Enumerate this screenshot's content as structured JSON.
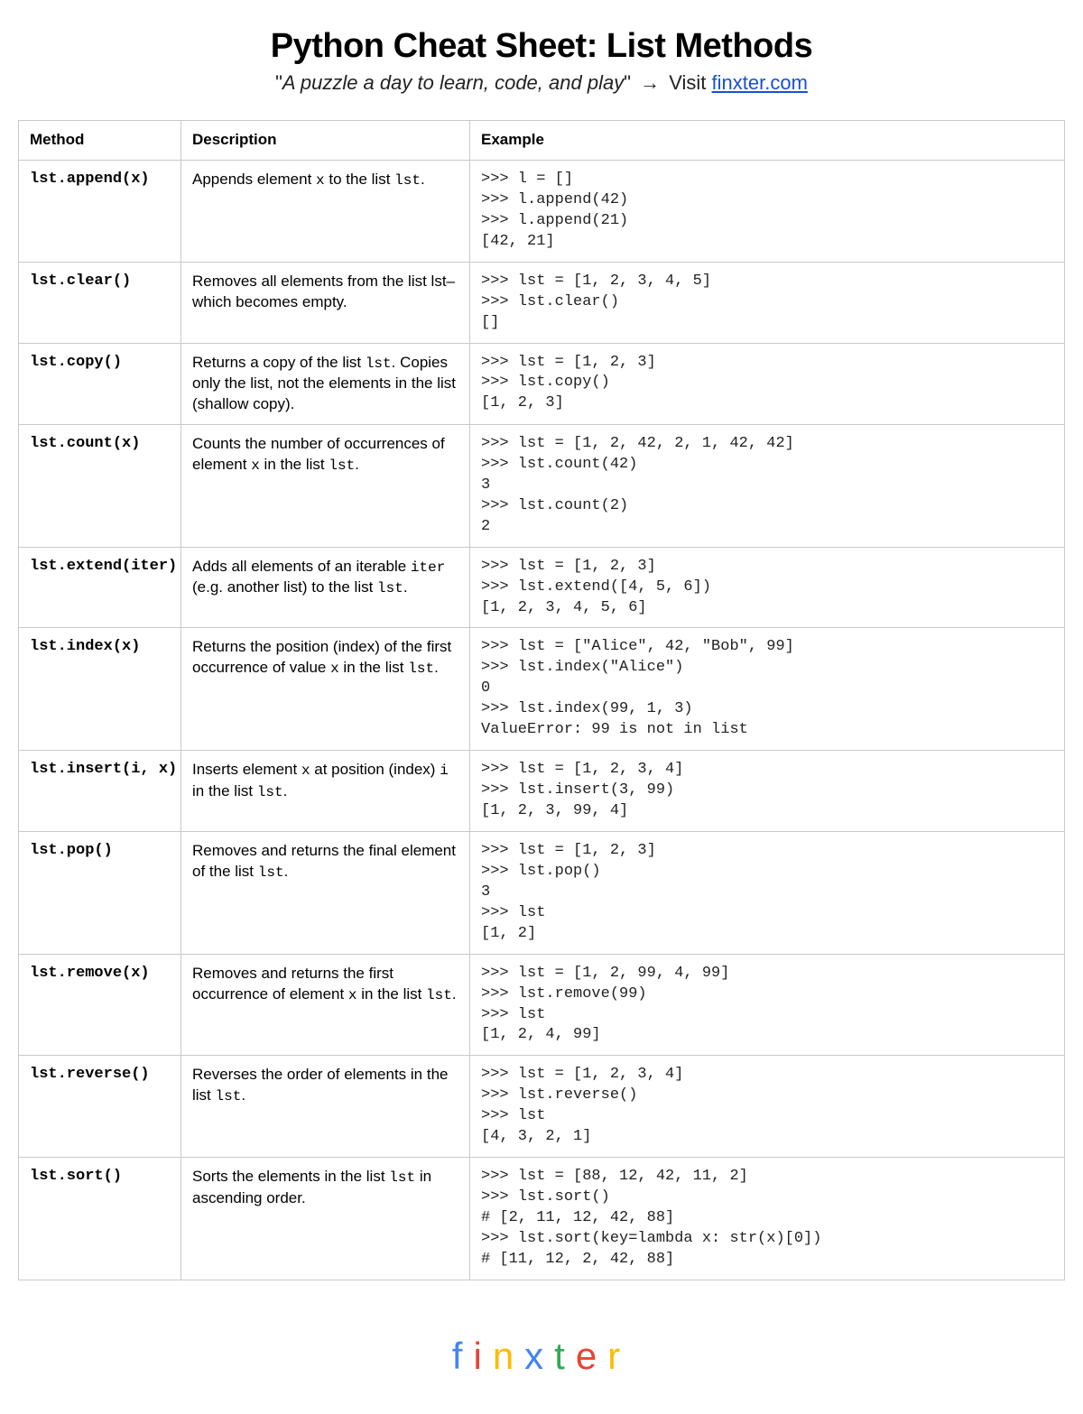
{
  "header": {
    "title": "Python Cheat Sheet: List Methods",
    "motto": "A puzzle a day to learn, code, and play",
    "visit_prefix": "Visit",
    "link_text": "finxter.com"
  },
  "table": {
    "headers": {
      "method": "Method",
      "description": "Description",
      "example": "Example"
    },
    "rows": [
      {
        "method": "lst.append(x)",
        "description": "Appends element <code>x</code> to the list <code>lst</code>.",
        "example": ">>> l = []\n>>> l.append(42)\n>>> l.append(21)\n[42, 21]"
      },
      {
        "method": "lst.clear()",
        "description": "Removes all elements from the list lst–which becomes empty.",
        "example": ">>> lst = [1, 2, 3, 4, 5]\n>>> lst.clear()\n[]"
      },
      {
        "method": "lst.copy()",
        "description": "Returns a copy of the list <code>lst</code>. Copies only the list, not the elements in the list (shallow copy).",
        "example": ">>> lst = [1, 2, 3]\n>>> lst.copy()\n[1, 2, 3]"
      },
      {
        "method": "lst.count(x)",
        "description": "Counts the number of occurrences of element <code>x</code> in the list <code>lst</code>.",
        "example": ">>> lst = [1, 2, 42, 2, 1, 42, 42]\n>>> lst.count(42)\n3\n>>> lst.count(2)\n2"
      },
      {
        "method": "lst.extend(iter)",
        "description": "Adds all elements of an iterable <code>iter</code>  (e.g. another list) to the list <code>lst</code>.",
        "example": ">>> lst = [1, 2, 3]\n>>> lst.extend([4, 5, 6])\n[1, 2, 3, 4, 5, 6]"
      },
      {
        "method": "lst.index(x)",
        "description": "Returns the position (index) of the first occurrence of value <code>x</code> in the list <code>lst</code>.",
        "example": ">>> lst = [\"Alice\", 42, \"Bob\", 99]\n>>> lst.index(\"Alice\")\n0\n>>> lst.index(99, 1, 3)\nValueError: 99 is not in list"
      },
      {
        "method": "lst.insert(i, x)",
        "description": "Inserts element <code>x</code> at position (index) <code>i</code> in the list <code>lst</code>.",
        "example": ">>> lst = [1, 2, 3, 4]\n>>> lst.insert(3, 99)\n[1, 2, 3, 99, 4]"
      },
      {
        "method": "lst.pop()",
        "description": "Removes and returns the final element of the list <code>lst</code>.",
        "example": ">>> lst = [1, 2, 3]\n>>> lst.pop()\n3\n>>> lst\n[1, 2]"
      },
      {
        "method": "lst.remove(x)",
        "description": "Removes and returns the first occurrence of element <code>x</code> in the list <code>lst</code>.",
        "example": ">>> lst = [1, 2, 99, 4, 99]\n>>> lst.remove(99)\n>>> lst\n[1, 2, 4, 99]"
      },
      {
        "method": "lst.reverse()",
        "description": "Reverses the order of elements in the list <code>lst</code>.",
        "example": ">>> lst = [1, 2, 3, 4]\n>>> lst.reverse()\n>>> lst\n[4, 3, 2, 1]"
      },
      {
        "method": "lst.sort()",
        "description": "Sorts the elements in the list <code>lst</code> in ascending order.",
        "example": ">>> lst = [88, 12, 42, 11, 2]\n>>> lst.sort()\n# [2, 11, 12, 42, 88]\n>>> lst.sort(key=lambda x: str(x)[0])\n# [11, 12, 2, 42, 88]"
      }
    ]
  },
  "footer": {
    "logo_letters": [
      "f",
      "i",
      "n",
      "x",
      "t",
      "e",
      "r"
    ]
  }
}
